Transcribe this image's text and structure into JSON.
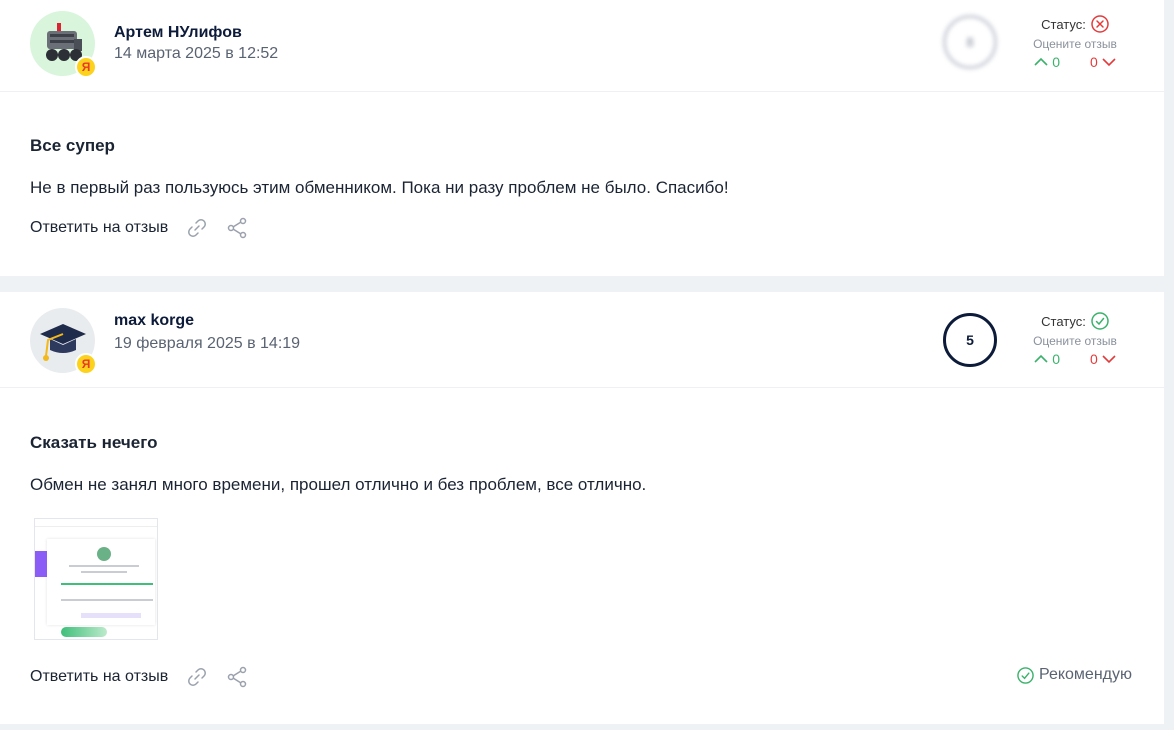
{
  "reviews": [
    {
      "author": "Артем НУлифов",
      "date": "14 марта 2025 в 12:52",
      "score": "8",
      "status_label": "Статус:",
      "rate_label": "Оцените отзыв",
      "votes_up": "0",
      "votes_down": "0",
      "status": "rejected",
      "title": "Все супер",
      "text": "Не в первый раз пользуюсь этим обменником. Пока ни разу проблем не было. Спасибо!",
      "reply_label": "Ответить на отзыв"
    },
    {
      "author": "max korge",
      "date": "19 февраля 2025 в 14:19",
      "score": "5",
      "status_label": "Статус:",
      "rate_label": "Оцените отзыв",
      "votes_up": "0",
      "votes_down": "0",
      "status": "approved",
      "title": "Сказать нечего",
      "text": "Обмен не занял много времени, прошел отлично и без проблем, все отлично.",
      "reply_label": "Ответить на отзыв",
      "recommend_label": "Рекомендую"
    }
  ],
  "badge_letter": "Я",
  "colors": {
    "positive": "#3bb26b",
    "negative": "#e33b3b",
    "text_dark": "#0d1b3a",
    "badge_yellow": "#fcd21c"
  },
  "icons": {
    "status_rejected": "x-circle-icon",
    "status_approved": "check-circle-icon",
    "link": "link-icon",
    "share": "share-icon",
    "vote_up": "chevron-up-icon",
    "vote_down": "chevron-down-icon",
    "recommend": "check-circle-icon"
  }
}
